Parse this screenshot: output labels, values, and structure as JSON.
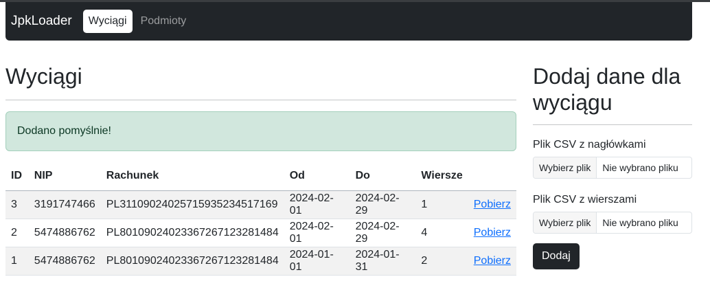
{
  "navbar": {
    "brand": "JpkLoader",
    "links": [
      {
        "label": "Wyciągi",
        "active": true
      },
      {
        "label": "Podmioty",
        "active": false
      }
    ]
  },
  "main": {
    "title": "Wyciągi",
    "alert": "Dodano pomyślnie!",
    "table": {
      "headers": [
        "ID",
        "NIP",
        "Rachunek",
        "Od",
        "Do",
        "Wiersze",
        ""
      ],
      "rows": [
        {
          "id": "3",
          "nip": "3191747466",
          "account": "PL31109024025715935234517169",
          "from": "2024-02-01",
          "to": "2024-02-29",
          "rows": "1",
          "action": "Pobierz"
        },
        {
          "id": "2",
          "nip": "5474886762",
          "account": "PL80109024023367267123281484",
          "from": "2024-02-01",
          "to": "2024-02-29",
          "rows": "4",
          "action": "Pobierz"
        },
        {
          "id": "1",
          "nip": "5474886762",
          "account": "PL80109024023367267123281484",
          "from": "2024-01-01",
          "to": "2024-01-31",
          "rows": "2",
          "action": "Pobierz"
        }
      ]
    }
  },
  "side": {
    "title": "Dodaj dane dla wyciągu",
    "header_file": {
      "label": "Plik CSV z nagłówkami",
      "button": "Wybierz plik",
      "status": "Nie wybrano pliku"
    },
    "rows_file": {
      "label": "Plik CSV z wierszami",
      "button": "Wybierz plik",
      "status": "Nie wybrano pliku"
    },
    "submit": "Dodaj"
  },
  "colors": {
    "navbar_bg": "#212529",
    "alert_bg": "#d1e7dd",
    "alert_text": "#0a3622",
    "link": "#0d6efd"
  }
}
